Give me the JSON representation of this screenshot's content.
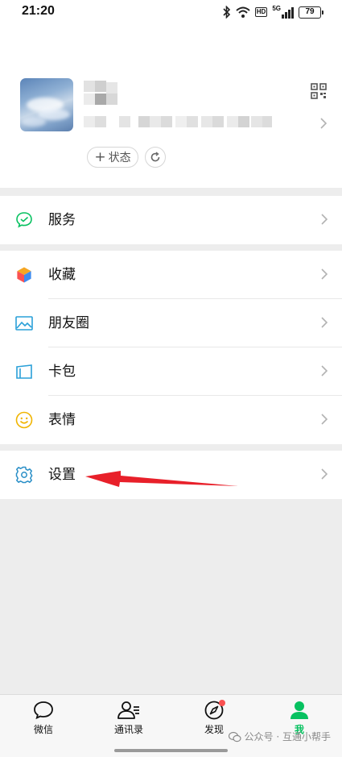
{
  "status_bar": {
    "time": "21:20",
    "signal_label": "5G",
    "hd_label": "HD",
    "battery": "79"
  },
  "profile": {
    "status_button_label": "状态"
  },
  "menu": {
    "services": {
      "label": "服务",
      "icon": "wechat-pay-icon"
    },
    "favorites": {
      "label": "收藏",
      "icon": "cube-icon"
    },
    "moments": {
      "label": "朋友圈",
      "icon": "image-icon"
    },
    "cards": {
      "label": "卡包",
      "icon": "wallet-icon"
    },
    "stickers": {
      "label": "表情",
      "icon": "smiley-icon"
    },
    "settings": {
      "label": "设置",
      "icon": "gear-icon"
    }
  },
  "tabbar": {
    "chats": "微信",
    "contacts": "通讯录",
    "discover": "发现",
    "me": "我"
  },
  "watermark": {
    "text": "公众号 · 互通小帮手"
  },
  "colors": {
    "accent_green": "#07c160",
    "annotation_red": "#e8202a",
    "badge_red": "#fa5151",
    "background": "#ededed"
  }
}
